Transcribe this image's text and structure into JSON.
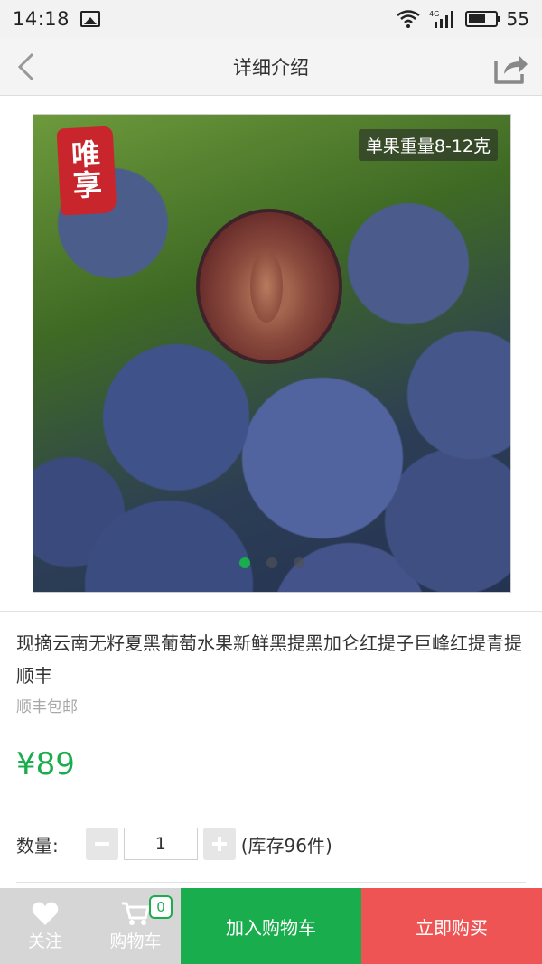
{
  "status_bar": {
    "time": "14:18",
    "battery": "55",
    "network": "4G"
  },
  "nav": {
    "title": "详细介绍"
  },
  "gallery": {
    "logo_text": [
      "唯",
      "享"
    ],
    "badge": "单果重量8-12克",
    "slide_count": 3,
    "active_slide": 0
  },
  "product": {
    "title": "现摘云南无籽夏黑葡萄水果新鲜黑提黑加仑红提子巨峰红提青提顺丰",
    "shipping": "顺丰包邮",
    "price": "¥89"
  },
  "quantity": {
    "label": "数量:",
    "value": "1",
    "stock": "(库存96件)"
  },
  "bottom_bar": {
    "follow_label": "关注",
    "cart_label": "购物车",
    "cart_count": "0",
    "add_to_cart_label": "加入购物车",
    "buy_now_label": "立即购买"
  },
  "colors": {
    "accent": "#1aad4e",
    "buy": "#ef5454",
    "muted": "#d6d6d6"
  }
}
